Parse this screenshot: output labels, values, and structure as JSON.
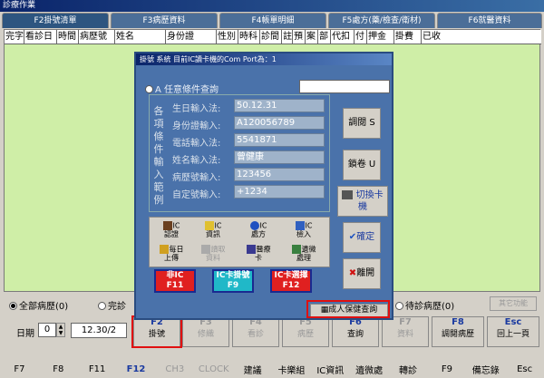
{
  "window": {
    "title": "診療作業"
  },
  "tabs": [
    {
      "label": "F2掛號清單"
    },
    {
      "label": "F3病歷資料"
    },
    {
      "label": "F4帳單明細"
    },
    {
      "label": "F5處方(藥/檢查/衛材)"
    },
    {
      "label": "F6就醫資料"
    }
  ],
  "grid": {
    "columns": [
      "完字號",
      "看診日",
      "時間",
      "病歷號",
      "姓名",
      "身份證",
      "性別",
      "時科",
      "診間",
      "註",
      "預",
      "案",
      "部",
      "代扣",
      "付",
      "押金",
      "掛費",
      "已收"
    ]
  },
  "filter": {
    "all": "全部病歷(0)",
    "done": "完診",
    "wait": "待診病歷(0)",
    "other_btn": "其它功能"
  },
  "toolbar": {
    "date_label": "日期",
    "date_num": "0",
    "date_value": "12.30/2",
    "buttons": [
      {
        "key": "F2",
        "label": "掛號"
      },
      {
        "key": "F3",
        "label": "修織"
      },
      {
        "key": "F4",
        "label": "看診"
      },
      {
        "key": "F5",
        "label": "病歷"
      },
      {
        "key": "F6",
        "label": "查詢"
      },
      {
        "key": "F7",
        "label": "資料"
      },
      {
        "key": "F8",
        "label": "調閱病歷"
      },
      {
        "key": "Esc",
        "label": "回上一頁"
      }
    ]
  },
  "fkeys": [
    "F7",
    "F8",
    "F11",
    "F12",
    "CH3",
    "CLOCK",
    "建議",
    "卡樂組",
    "IC資訊",
    "遺微處",
    "轉診",
    "F9",
    "備忘錄",
    "Esc"
  ],
  "dialog": {
    "title": "掛號 系統 目前IC讀卡機的Com Port為：1",
    "query_label": "A 任意條件查詢",
    "side_label": "各項條件輸入範例",
    "rows": [
      {
        "label": "生日輸入法:",
        "value": "50.12.31"
      },
      {
        "label": "身份證輸入:",
        "value": "A120056789"
      },
      {
        "label": "電話輸入法:",
        "value": "5541871"
      },
      {
        "label": "姓名輸入法:",
        "value": "曾健康"
      },
      {
        "label": "病歷號輸入:",
        "value": "123456"
      },
      {
        "label": "自定號輸入:",
        "value": "+1234"
      }
    ],
    "side_buttons": {
      "open": "調閱 S",
      "lock": "鎖卷 U",
      "switch": "切換卡機",
      "ok": "確定",
      "leave": "離開"
    },
    "icons": [
      {
        "a": "IC",
        "b": "認證"
      },
      {
        "a": "IC",
        "b": "資訊"
      },
      {
        "a": "IC",
        "b": "處方"
      },
      {
        "a": "IC",
        "b": "檢入"
      },
      {
        "a": "每日",
        "b": "上傳"
      },
      {
        "a": "讀取",
        "b": "資料"
      },
      {
        "a": "醫療",
        "b": "卡"
      },
      {
        "a": "遺微",
        "b": "處理"
      }
    ],
    "fbuttons": [
      {
        "top": "非IC",
        "key": "F11"
      },
      {
        "top": "IC卡掛號",
        "key": "F9"
      },
      {
        "top": "IC卡選擇",
        "key": "F12"
      }
    ],
    "bottom": "成人保健查詢"
  }
}
